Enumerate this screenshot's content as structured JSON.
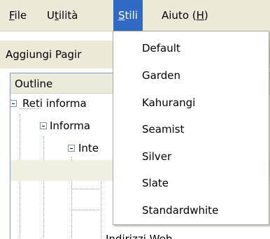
{
  "menubar": {
    "file": {
      "prefix": "",
      "accel": "F",
      "suffix": "ile"
    },
    "utilita": {
      "prefix": "U",
      "accel": "t",
      "suffix": "ilità"
    },
    "stili": {
      "prefix": "",
      "accel": "S",
      "suffix": "tili"
    },
    "aiuto": {
      "prefix": "Aiuto (",
      "accel": "H",
      "suffix": ")"
    }
  },
  "toolbar": {
    "add_page_label": "Aggiungi Pagir"
  },
  "outline": {
    "header": "Outline",
    "rows": [
      "Reti informa",
      "Informa",
      "Inte",
      "",
      "",
      "Indirizzi Web"
    ]
  },
  "styles_menu": {
    "items": [
      "Default",
      "Garden",
      "Kahurangi",
      "Seamist",
      "Silver",
      "Slate",
      "Standardwhite"
    ]
  },
  "colors": {
    "menu_highlight": "#316ac5",
    "menubar_bg": "#ece9d8"
  }
}
